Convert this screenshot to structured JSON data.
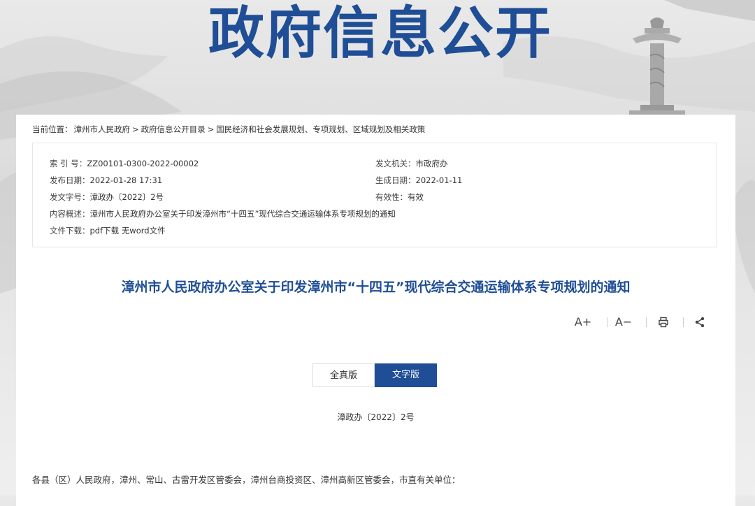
{
  "banner": {
    "title": "政府信息公开"
  },
  "breadcrumb": {
    "prefix": "当前位置：",
    "items": [
      "漳州市人民政府",
      "政府信息公开目录",
      "国民经济和社会发展规划、专项规划、区域规划及相关政策"
    ],
    "separator": ">"
  },
  "meta": {
    "index_label": "索 引 号：",
    "index_value": "ZZ00101-0300-2022-00002",
    "issuer_label": "发文机关：",
    "issuer_value": "市政府办",
    "publish_label": "发布日期：",
    "publish_value": "2022-01-28 17:31",
    "effective_date_label": "生成日期：",
    "effective_date_value": "2022-01-11",
    "docno_label": "发文字号：",
    "docno_value": "漳政办〔2022〕2号",
    "validity_label": "有效性：",
    "validity_value": "有效",
    "summary_label": "内容概述：",
    "summary_value": "漳州市人民政府办公室关于印发漳州市“十四五”现代综合交通运输体系专项规划的通知",
    "download_label": "文件下载：",
    "download_pdf": "pdf下载",
    "download_word": "无word文件"
  },
  "document": {
    "title": "漳州市人民政府办公室关于印发漳州市“十四五”现代综合交通运输体系专项规划的通知",
    "number": "漳政办〔2022〕2号",
    "salutation": "各县（区）人民政府，漳州、常山、古雷开发区管委会，漳州台商投资区、漳州高新区管委会，市直有关单位："
  },
  "tools": {
    "increase": "A+",
    "decrease": "A−"
  },
  "tabs": {
    "full": "全真版",
    "text": "文字版"
  },
  "colors": {
    "accent": "#1f4e96"
  }
}
